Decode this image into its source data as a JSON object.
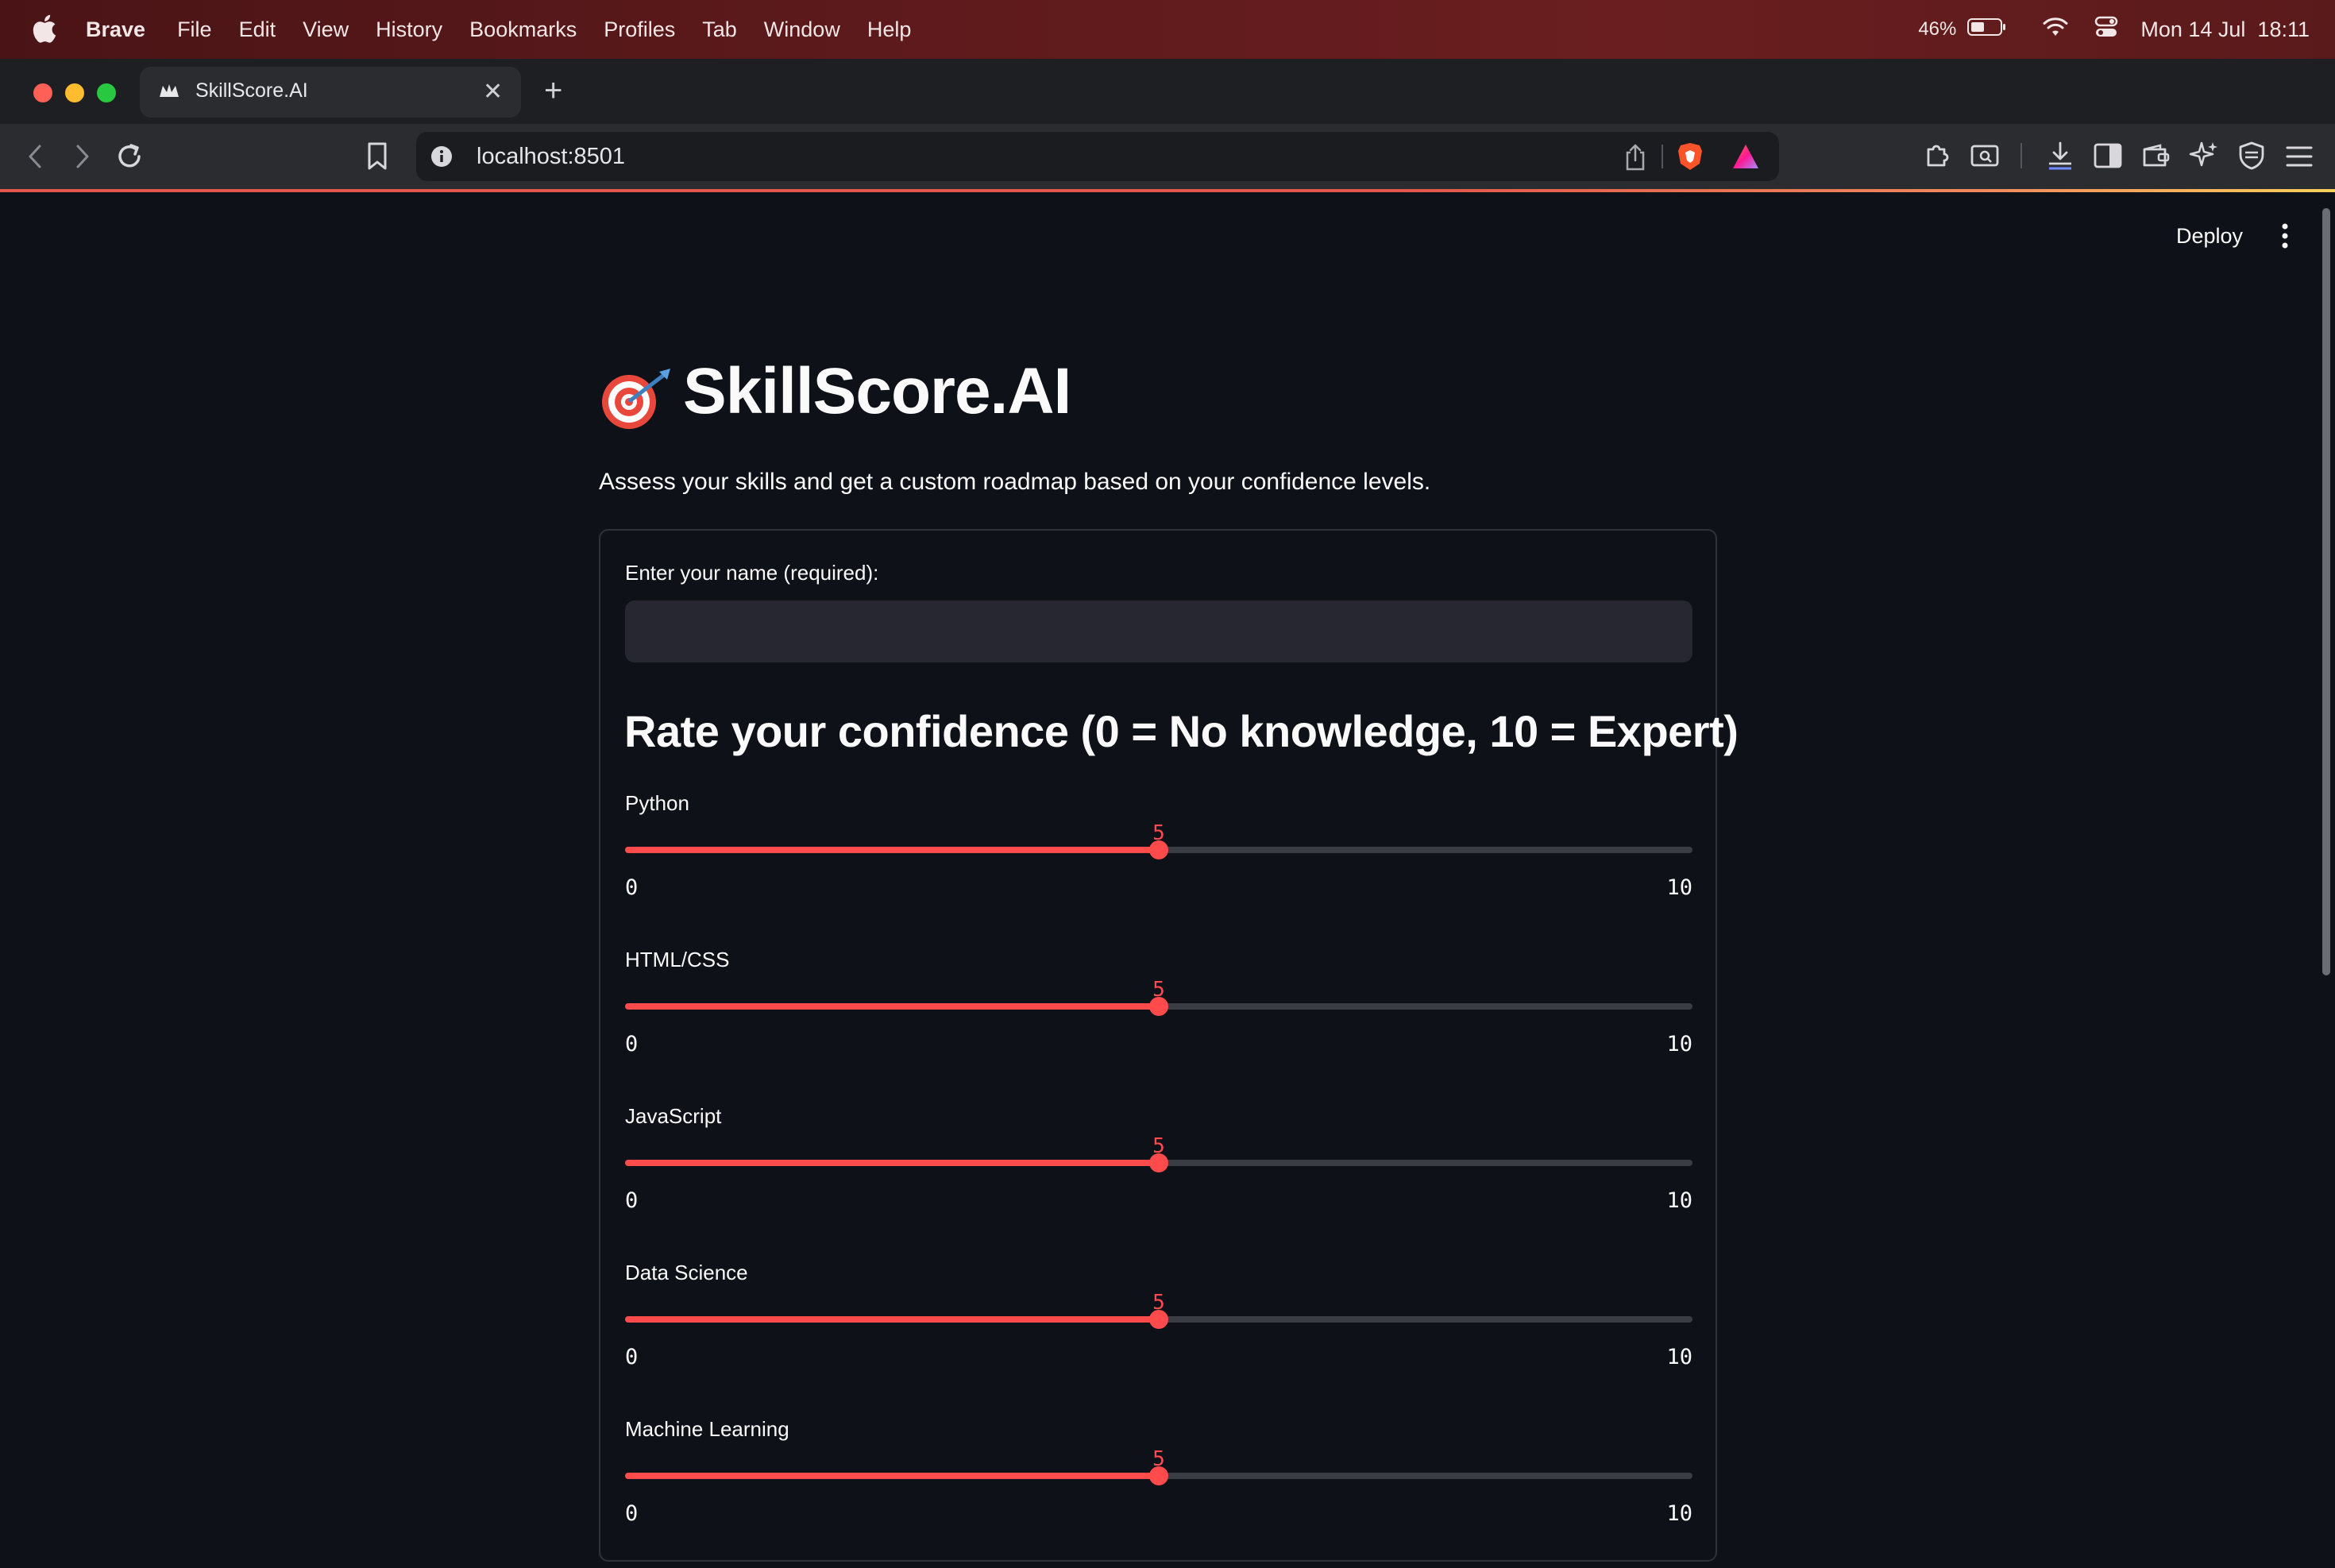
{
  "menubar": {
    "app_name": "Brave",
    "items": [
      "File",
      "Edit",
      "View",
      "History",
      "Bookmarks",
      "Profiles",
      "Tab",
      "Window",
      "Help"
    ],
    "battery_percent": "46%",
    "datetime": "Mon 14 Jul  18:11"
  },
  "browser": {
    "tab_title": "SkillScore.AI",
    "url": "localhost:8501"
  },
  "app": {
    "deploy_label": "Deploy",
    "title": "SkillScore.AI",
    "subtitle": "Assess your skills and get a custom roadmap based on your confidence levels.",
    "name_label": "Enter your name (required):",
    "name_value": "",
    "section_heading": "Rate your confidence (0 = No knowledge, 10 = Expert)",
    "sliders": [
      {
        "label": "Python",
        "value": 5,
        "min": 0,
        "max": 10
      },
      {
        "label": "HTML/CSS",
        "value": 5,
        "min": 0,
        "max": 10
      },
      {
        "label": "JavaScript",
        "value": 5,
        "min": 0,
        "max": 10
      },
      {
        "label": "Data Science",
        "value": 5,
        "min": 0,
        "max": 10
      },
      {
        "label": "Machine Learning",
        "value": 5,
        "min": 0,
        "max": 10
      }
    ]
  },
  "colors": {
    "accent": "#ff4b4b",
    "background": "#0e1117",
    "input_bg": "#262730"
  }
}
